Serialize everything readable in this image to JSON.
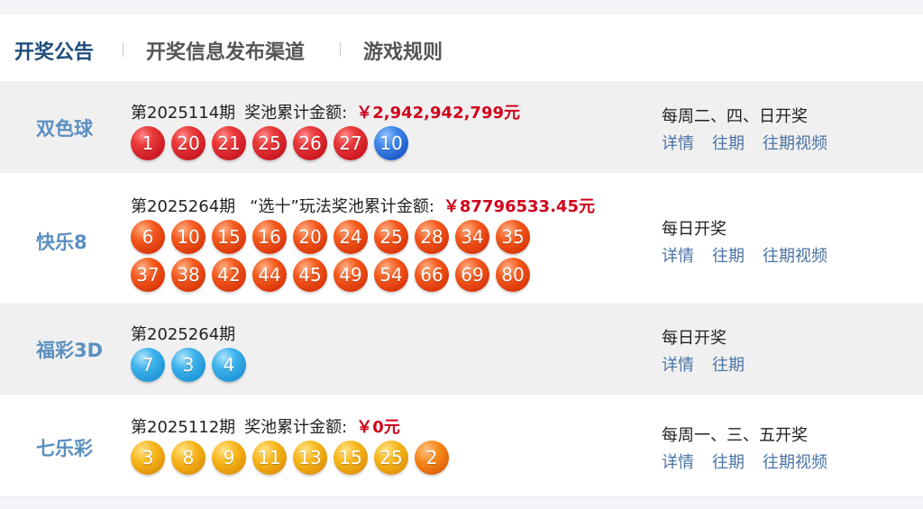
{
  "tabs": [
    "开奖公告",
    "开奖信息发布渠道",
    "游戏规则"
  ],
  "games": [
    {
      "name": "双色球",
      "issue": "第2025114期",
      "pool_label": "奖池累计金额:",
      "pool_amount": "￥2,942,942,799元",
      "schedule": "每周二、四、日开奖",
      "links": [
        "详情",
        "往期",
        "往期视频"
      ],
      "balls": [
        {
          "n": "1",
          "c": "red"
        },
        {
          "n": "20",
          "c": "red"
        },
        {
          "n": "21",
          "c": "red"
        },
        {
          "n": "25",
          "c": "red"
        },
        {
          "n": "26",
          "c": "red"
        },
        {
          "n": "27",
          "c": "red"
        },
        {
          "n": "10",
          "c": "blue"
        }
      ]
    },
    {
      "name": "快乐8",
      "issue": "第2025264期",
      "pool_label": "“选十”玩法奖池累计金额:",
      "pool_amount": "￥87796533.45元",
      "schedule": "每日开奖",
      "links": [
        "详情",
        "往期",
        "往期视频"
      ],
      "balls": [
        {
          "n": "6",
          "c": "orange"
        },
        {
          "n": "10",
          "c": "orange"
        },
        {
          "n": "15",
          "c": "orange"
        },
        {
          "n": "16",
          "c": "orange"
        },
        {
          "n": "20",
          "c": "orange"
        },
        {
          "n": "24",
          "c": "orange"
        },
        {
          "n": "25",
          "c": "orange"
        },
        {
          "n": "28",
          "c": "orange"
        },
        {
          "n": "34",
          "c": "orange"
        },
        {
          "n": "35",
          "c": "orange"
        },
        {
          "n": "37",
          "c": "orange"
        },
        {
          "n": "38",
          "c": "orange"
        },
        {
          "n": "42",
          "c": "orange"
        },
        {
          "n": "44",
          "c": "orange"
        },
        {
          "n": "45",
          "c": "orange"
        },
        {
          "n": "49",
          "c": "orange"
        },
        {
          "n": "54",
          "c": "orange"
        },
        {
          "n": "66",
          "c": "orange"
        },
        {
          "n": "69",
          "c": "orange"
        },
        {
          "n": "80",
          "c": "orange"
        }
      ]
    },
    {
      "name": "福彩3D",
      "issue": "第2025264期",
      "pool_label": "",
      "pool_amount": "",
      "schedule": "每日开奖",
      "links": [
        "详情",
        "往期"
      ],
      "balls": [
        {
          "n": "7",
          "c": "sky"
        },
        {
          "n": "3",
          "c": "sky"
        },
        {
          "n": "4",
          "c": "sky"
        }
      ]
    },
    {
      "name": "七乐彩",
      "issue": "第2025112期",
      "pool_label": "奖池累计金额:",
      "pool_amount": "￥0元",
      "schedule": "每周一、三、五开奖",
      "links": [
        "详情",
        "往期",
        "往期视频"
      ],
      "balls": [
        {
          "n": "3",
          "c": "gold"
        },
        {
          "n": "8",
          "c": "gold"
        },
        {
          "n": "9",
          "c": "gold"
        },
        {
          "n": "11",
          "c": "gold"
        },
        {
          "n": "13",
          "c": "gold"
        },
        {
          "n": "15",
          "c": "gold"
        },
        {
          "n": "25",
          "c": "gold"
        },
        {
          "n": "2",
          "c": "amber"
        }
      ]
    }
  ]
}
